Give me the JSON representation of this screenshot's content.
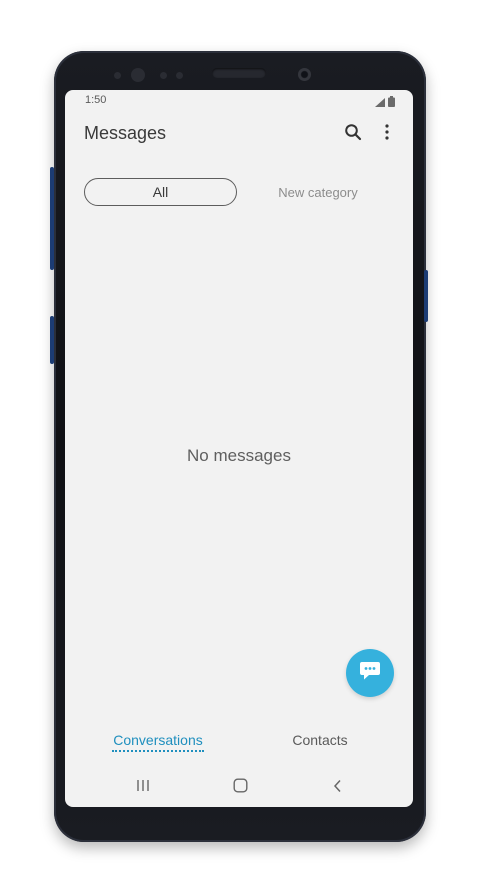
{
  "status_bar": {
    "time": "1:50",
    "signal_icon": "signal-icon",
    "battery_icon": "battery-icon"
  },
  "header": {
    "title": "Messages",
    "search_icon": "search-icon",
    "more_icon": "more-vert-icon"
  },
  "categories": {
    "all_label": "All",
    "new_label": "New category"
  },
  "main": {
    "empty_text": "No messages"
  },
  "fab": {
    "icon": "compose-message-icon",
    "color": "#35b1dd"
  },
  "bottom_tabs": {
    "conversations_label": "Conversations",
    "contacts_label": "Contacts",
    "active_color": "#1f8fbe"
  },
  "nav_bar": {
    "recents_icon": "recents-icon",
    "home_icon": "home-icon",
    "back_icon": "back-icon"
  }
}
